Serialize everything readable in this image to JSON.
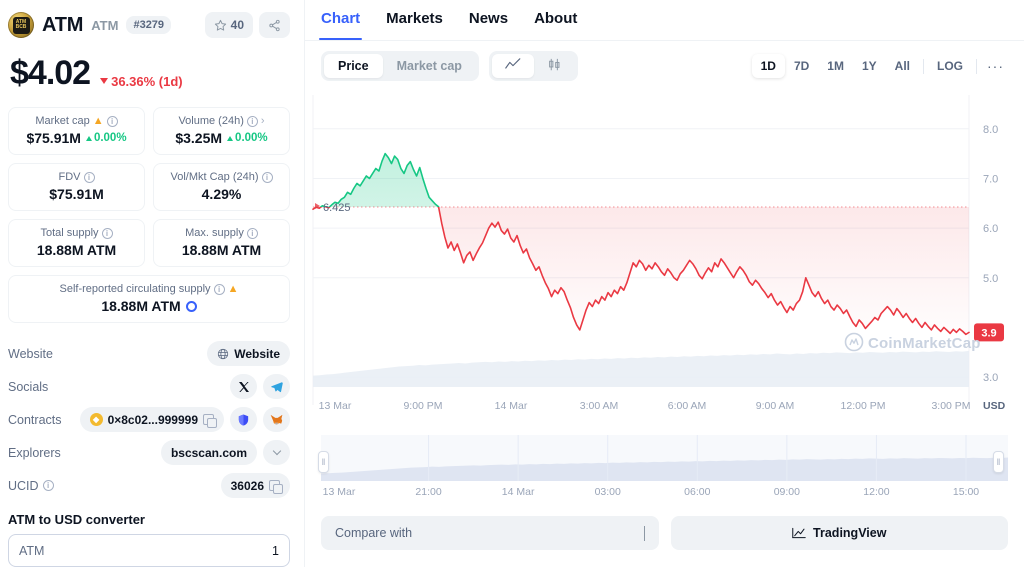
{
  "coin": {
    "symbol_logo": "atm-coin-logo",
    "name": "ATM",
    "ticker": "ATM",
    "rank": "#3279",
    "watch_count": "40",
    "price": "$4.02",
    "change_pct": "36.36% (1d)",
    "change_dir": "down"
  },
  "stats": [
    {
      "label": "Market cap",
      "value": "$75.91M",
      "sub": "0.00%",
      "sub_dir": "up",
      "info": true,
      "warn": true,
      "arrow": false
    },
    {
      "label": "Volume (24h)",
      "value": "$3.25M",
      "sub": "0.00%",
      "sub_dir": "up",
      "info": true,
      "warn": false,
      "arrow": true
    },
    {
      "label": "FDV",
      "value": "$75.91M",
      "sub": "",
      "info": true,
      "warn": false,
      "arrow": false
    },
    {
      "label": "Vol/Mkt Cap (24h)",
      "value": "4.29%",
      "sub": "",
      "info": true,
      "warn": false,
      "arrow": false
    },
    {
      "label": "Total supply",
      "value": "18.88M ATM",
      "sub": "",
      "info": true,
      "warn": false,
      "arrow": false
    },
    {
      "label": "Max. supply",
      "value": "18.88M ATM",
      "sub": "",
      "info": true,
      "warn": false,
      "arrow": false
    },
    {
      "label": "Self-reported circulating supply",
      "value": "18.88M ATM",
      "sub": "",
      "info": true,
      "warn": true,
      "arrow": false,
      "ring": true
    }
  ],
  "links": {
    "website_label": "Website",
    "website_btn": "Website",
    "socials_label": "Socials",
    "contracts_label": "Contracts",
    "contract_address": "0×8c02...999999",
    "explorers_label": "Explorers",
    "explorer_value": "bscscan.com",
    "ucid_label": "UCID",
    "ucid_value": "36026"
  },
  "converter": {
    "title": "ATM to USD converter",
    "currency": "ATM",
    "amount": "1"
  },
  "tabs": [
    {
      "label": "Chart",
      "active": true
    },
    {
      "label": "Markets",
      "active": false
    },
    {
      "label": "News",
      "active": false
    },
    {
      "label": "About",
      "active": false
    }
  ],
  "chart_controls": {
    "modes": [
      {
        "label": "Price",
        "active": true
      },
      {
        "label": "Market cap",
        "active": false
      }
    ],
    "chart_types": [
      {
        "icon": "line-chart-icon",
        "active": true
      },
      {
        "icon": "candlestick-chart-icon",
        "active": false
      }
    ],
    "ranges": [
      {
        "label": "1D",
        "active": true
      },
      {
        "label": "7D",
        "active": false
      },
      {
        "label": "1M",
        "active": false
      },
      {
        "label": "1Y",
        "active": false
      },
      {
        "label": "All",
        "active": false
      }
    ],
    "log_label": "LOG",
    "more_label": "···"
  },
  "bottom": {
    "compare_label": "Compare with",
    "tradingview_label": "TradingView"
  },
  "chart_data": {
    "type": "area",
    "title": "",
    "xlabel": "",
    "ylabel": "USD",
    "y_unit": "USD",
    "ylim": [
      2.8,
      8.6
    ],
    "yticks": [
      8.0,
      7.0,
      6.0,
      5.0,
      3.0
    ],
    "ytick_labels": [
      "8.0",
      "7.0",
      "6.0",
      "5.0",
      "3.0"
    ],
    "xticks": [
      "13 Mar",
      "9:00 PM",
      "14 Mar",
      "3:00 AM",
      "6:00 AM",
      "9:00 AM",
      "12:00 PM",
      "3:00 PM"
    ],
    "grid": true,
    "baseline_value": 6.425,
    "baseline_label": "6.425",
    "current_price_tag": "3.9",
    "colors": {
      "up": "#16c784",
      "down": "#ea3943",
      "grid": "#f0f2f6",
      "axis_text": "#9aa5b8"
    },
    "watermark": "CoinMarketCap",
    "legend_position": "none",
    "series": [
      {
        "name": "ATM price (USD)",
        "values": [
          6.38,
          6.42,
          6.4,
          6.45,
          6.43,
          6.41,
          6.47,
          6.52,
          6.5,
          6.58,
          6.62,
          6.72,
          6.68,
          6.8,
          6.9,
          6.85,
          6.95,
          7.05,
          7.0,
          7.1,
          7.2,
          7.15,
          7.35,
          7.5,
          7.42,
          7.3,
          7.45,
          7.38,
          7.2,
          7.1,
          7.26,
          7.34,
          7.18,
          7.05,
          7.22,
          7.0,
          6.8,
          6.62,
          6.55,
          6.48,
          6.43,
          6.1,
          5.82,
          5.6,
          5.72,
          5.55,
          5.68,
          5.5,
          5.3,
          5.45,
          5.52,
          5.35,
          5.48,
          5.6,
          5.7,
          5.85,
          6.0,
          6.1,
          6.02,
          6.12,
          5.95,
          5.88,
          5.98,
          5.8,
          5.72,
          5.85,
          5.65,
          5.5,
          5.58,
          5.4,
          5.28,
          5.15,
          5.22,
          5.05,
          4.9,
          4.78,
          4.62,
          4.75,
          4.68,
          4.8,
          4.72,
          4.55,
          4.4,
          4.2,
          4.05,
          3.95,
          4.15,
          4.35,
          4.5,
          4.42,
          4.55,
          4.48,
          4.62,
          4.55,
          4.7,
          4.62,
          4.75,
          4.68,
          4.82,
          4.75,
          4.9,
          5.1,
          5.3,
          5.22,
          5.35,
          5.28,
          5.15,
          5.25,
          5.18,
          5.3,
          5.22,
          5.12,
          5.05,
          5.18,
          5.1,
          5.0,
          4.95,
          5.08,
          5.15,
          5.25,
          5.35,
          5.28,
          5.18,
          5.05,
          4.98,
          5.1,
          5.2,
          5.12,
          5.3,
          5.22,
          5.38,
          5.3,
          5.2,
          5.1,
          5.0,
          5.12,
          5.22,
          5.15,
          5.05,
          4.92,
          4.85,
          4.95,
          4.88,
          4.78,
          4.7,
          4.6,
          4.68,
          4.55,
          4.45,
          4.52,
          4.4,
          4.3,
          4.42,
          4.35,
          4.48,
          4.55,
          4.72,
          5.0,
          4.85,
          4.7,
          4.62,
          4.72,
          4.58,
          4.48,
          4.55,
          4.42,
          4.35,
          4.45,
          4.38,
          4.28,
          4.35,
          4.22,
          4.1,
          4.02,
          4.15,
          4.08,
          3.98,
          4.05,
          4.12,
          4.2,
          4.15,
          4.28,
          4.35,
          4.42,
          4.35,
          4.25,
          4.38,
          4.3,
          4.2,
          4.28,
          4.18,
          4.1,
          4.18,
          4.08,
          4.0,
          4.1,
          4.02,
          3.95,
          4.05,
          3.98,
          3.92,
          4.0,
          3.94,
          3.88,
          3.96,
          3.9,
          3.97,
          3.92,
          3.86,
          3.9
        ]
      }
    ],
    "volume_series": {
      "name": "Volume",
      "normalized": [
        0.3,
        0.31,
        0.33,
        0.34,
        0.36,
        0.38,
        0.4,
        0.42,
        0.44,
        0.46,
        0.48,
        0.5,
        0.52,
        0.54,
        0.55,
        0.56,
        0.58,
        0.57,
        0.59,
        0.6,
        0.61,
        0.62,
        0.63,
        0.62,
        0.64,
        0.65,
        0.66,
        0.65,
        0.67,
        0.66,
        0.68,
        0.67,
        0.69,
        0.68,
        0.7,
        0.69,
        0.71,
        0.7,
        0.72,
        0.71,
        0.73,
        0.72,
        0.74,
        0.73,
        0.75,
        0.74,
        0.76,
        0.75,
        0.77,
        0.76,
        0.78,
        0.77,
        0.79,
        0.78,
        0.8,
        0.79,
        0.81,
        0.8,
        0.82,
        0.81,
        0.83,
        0.82,
        0.84,
        0.83,
        0.85,
        0.84,
        0.86,
        0.85,
        0.87,
        0.86,
        0.88,
        0.87,
        0.86,
        0.88,
        0.87,
        0.89,
        0.88,
        0.9,
        0.89,
        0.91,
        0.9,
        0.89,
        0.91,
        0.9,
        0.92,
        0.91,
        0.9,
        0.92,
        0.91,
        0.93,
        0.92,
        0.91,
        0.93,
        0.92,
        0.94,
        0.93,
        0.92,
        0.94,
        0.93,
        0.95
      ]
    },
    "navigator": {
      "xticks": [
        "13 Mar",
        "21:00",
        "14 Mar",
        "03:00",
        "06:00",
        "09:00",
        "12:00",
        "15:00"
      ],
      "left_handle": "navigator-left-handle",
      "right_handle": "navigator-right-handle"
    }
  }
}
